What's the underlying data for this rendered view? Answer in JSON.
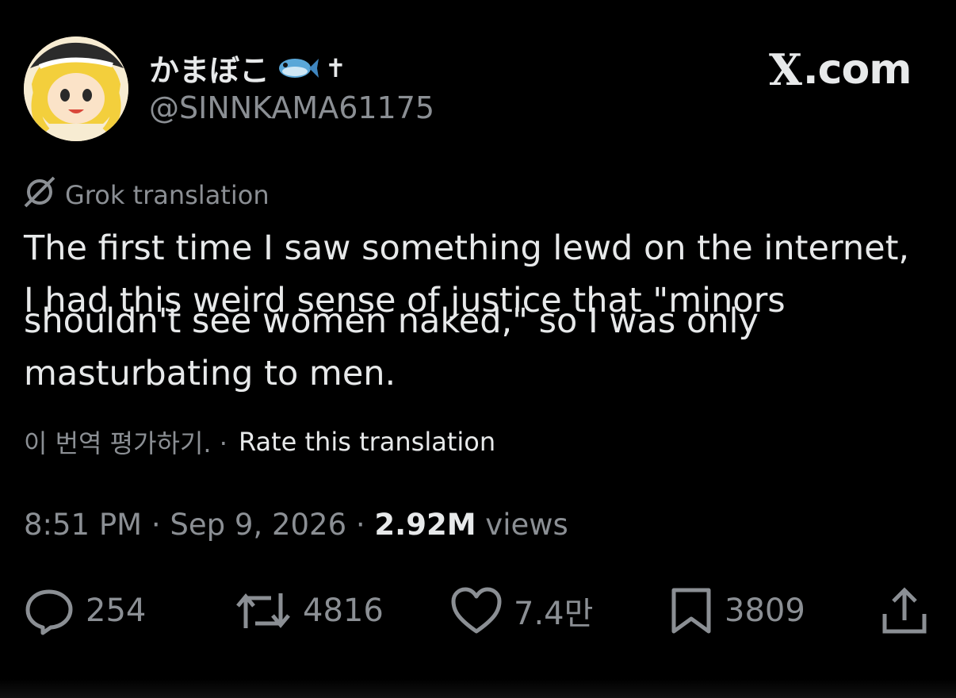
{
  "user": {
    "display_name": "かまぼこ",
    "cross": "✝",
    "handle": "@SINNKAMA61175"
  },
  "brand": {
    "x": "X",
    "domain": ".com"
  },
  "translation": {
    "label": "Grok translation",
    "lines": [
      "The first time I saw something lewd on the internet,",
      "I had this weird sense of justice that \"minors",
      "shouldn't see women naked,\" so I was only",
      "masturbating to men."
    ],
    "rate_prefix": "이 번역 평가하기. ·",
    "rate_link": "Rate this translation"
  },
  "meta": {
    "time": "8:51 PM",
    "date": "Sep 9, 2026",
    "views_count": "2.92M",
    "views_label": "views",
    "separator": "·"
  },
  "actions": {
    "replies": "254",
    "reposts": "4816",
    "likes": "7.4만",
    "bookmarks": "3809"
  },
  "colors": {
    "background": "#000000",
    "text": "#e7e9ea",
    "muted": "#8b8f94"
  }
}
